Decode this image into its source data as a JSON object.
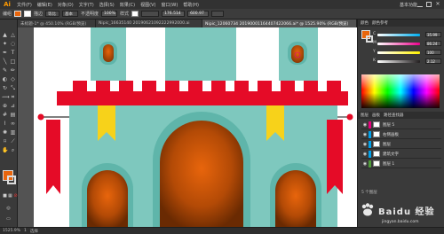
{
  "app": {
    "logo": "Ai"
  },
  "menu": [
    "文件(F)",
    "编辑(E)",
    "对象(O)",
    "文字(T)",
    "选择(S)",
    "效果(C)",
    "视图(V)",
    "窗口(W)",
    "帮助(H)"
  ],
  "workspace": "基本功能",
  "control": {
    "selection_label": "编组",
    "stroke_label": "描边",
    "opacity_label": "不透明度",
    "opacity_value": "100%",
    "style_label": "样式",
    "x_value": "176.514",
    "y_value": "600.97",
    "stroke_style": "基本",
    "profile": "等比"
  },
  "tabs": [
    {
      "label": "未标题-1* @ 450.10% (RGB/预览)"
    },
    {
      "label": "Nipic_16635140 20190621092222992000.ai"
    },
    {
      "label": "Nipic_12060734 20190001164407422066.ai* @ 1525.90% (RGB/预览)"
    }
  ],
  "right_panel": {
    "color_tabs": [
      "颜色",
      "颜色参考"
    ],
    "sliders": [
      {
        "label": "C",
        "value": "35.99",
        "color": "#00aeef"
      },
      {
        "label": "M",
        "value": "86.24",
        "color": "#ec008c"
      },
      {
        "label": "Y",
        "value": "100",
        "color": "#fff200"
      },
      {
        "label": "K",
        "value": "2.12",
        "color": "#231f20"
      }
    ],
    "layer_tabs": [
      "图层",
      "画板",
      "路径查找器"
    ],
    "layers": [
      {
        "name": "图层 5",
        "color": "#e6007e"
      },
      {
        "name": "右侧画板",
        "color": "#00a0e9"
      },
      {
        "name": "图层",
        "color": "#00a0e9"
      },
      {
        "name": "建筑文字",
        "color": "#00a0e9"
      },
      {
        "name": "图层 1",
        "color": "#4f9b39"
      }
    ],
    "layer_count": "5 个图层"
  },
  "status": {
    "zoom": "1525.9%",
    "mode": "选择",
    "page": "1"
  },
  "watermark": {
    "main": "Baidu 经验",
    "sub": "jingyan.baidu.com"
  },
  "artwork": {
    "teal": "#7ec8be",
    "dark_teal": "#5fb5aa",
    "red": "#e50b27",
    "yellow": "#f7d21a",
    "door_orange": "#e8650c",
    "door_dark": "#8a3a05",
    "white_flag": "#ffffff"
  }
}
